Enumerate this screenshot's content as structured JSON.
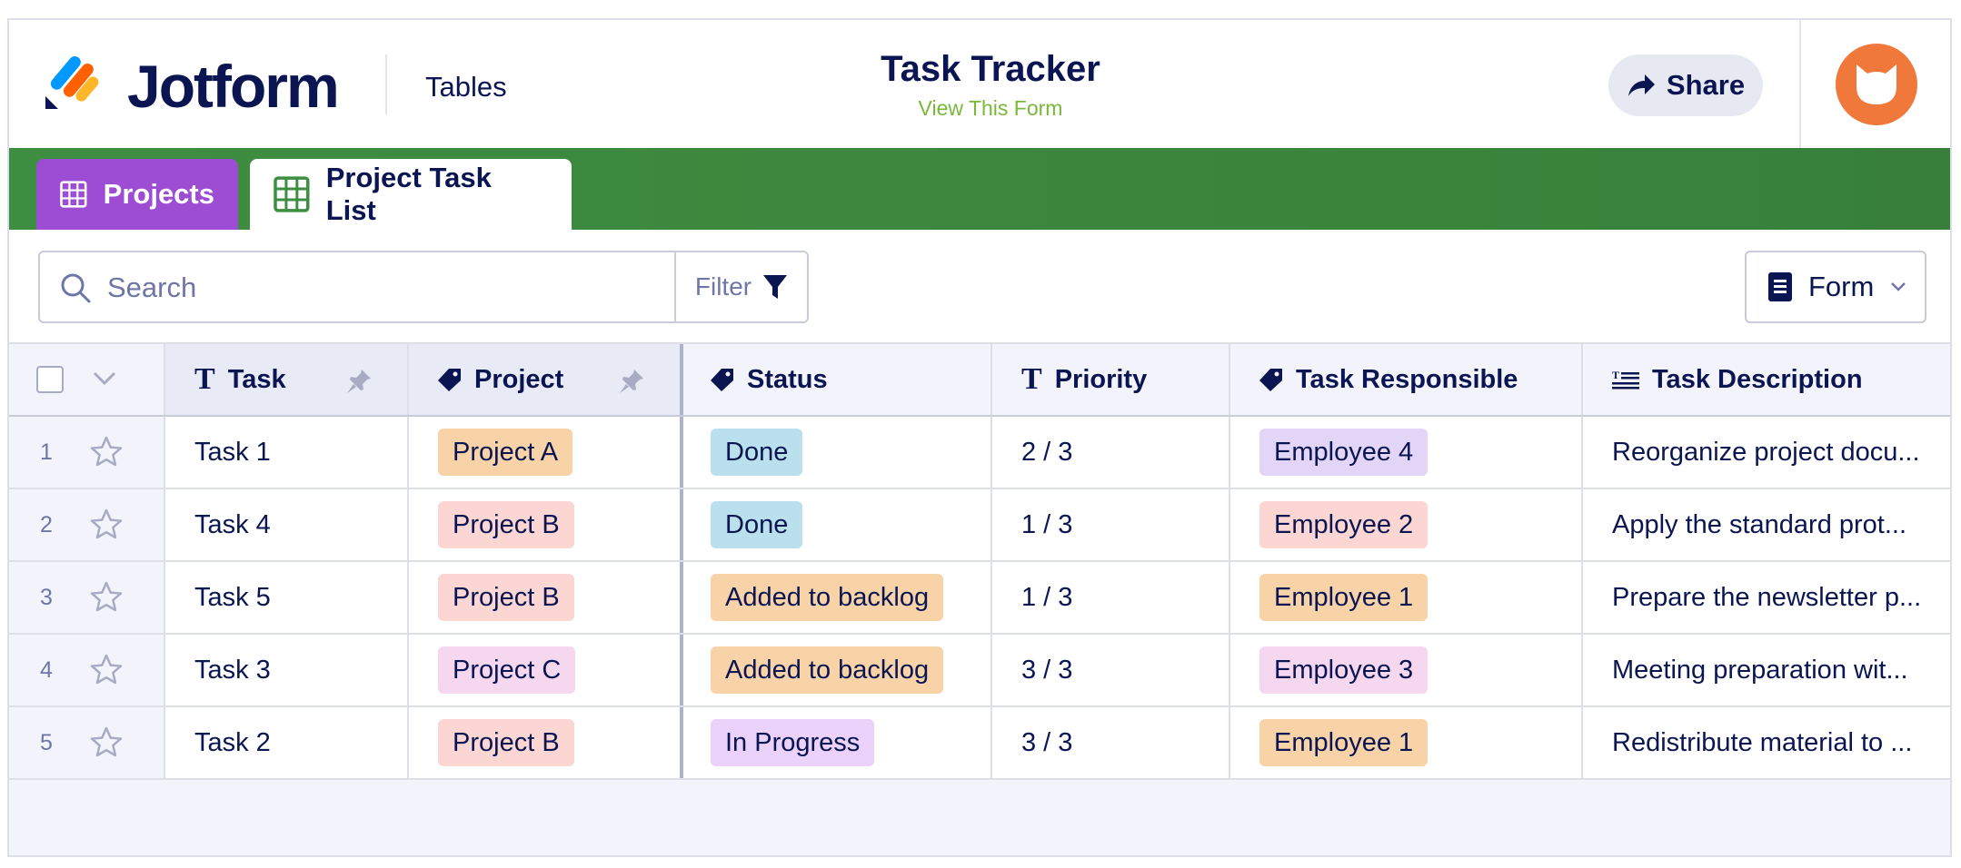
{
  "header": {
    "brand": "Jotform",
    "section": "Tables",
    "title": "Task Tracker",
    "view_form": "View This Form",
    "share_label": "Share"
  },
  "tabs": [
    {
      "label": "Projects",
      "color": "#9c4dd3",
      "icon": "grid-icon"
    },
    {
      "label": "Project Task List",
      "color": "#ffffff",
      "icon": "grid-icon"
    }
  ],
  "toolbar": {
    "search_placeholder": "Search",
    "filter_label": "Filter",
    "form_label": "Form"
  },
  "table": {
    "columns": [
      {
        "label": "Task",
        "icon": "text-type-icon"
      },
      {
        "label": "Project",
        "icon": "tag-icon"
      },
      {
        "label": "Status",
        "icon": "tag-icon"
      },
      {
        "label": "Priority",
        "icon": "text-type-icon"
      },
      {
        "label": "Task Responsible",
        "icon": "tag-icon"
      },
      {
        "label": "Task Description",
        "icon": "long-text-icon"
      }
    ],
    "rows": [
      {
        "num": "1",
        "task": "Task 1",
        "project": "Project A",
        "status": "Done",
        "priority": "2 / 3",
        "responsible": "Employee 4",
        "description": "Reorganize project docu..."
      },
      {
        "num": "2",
        "task": "Task 4",
        "project": "Project B",
        "status": "Done",
        "priority": "1 / 3",
        "responsible": "Employee 2",
        "description": "Apply the standard prot..."
      },
      {
        "num": "3",
        "task": "Task 5",
        "project": "Project B",
        "status": "Added to backlog",
        "priority": "1 / 3",
        "responsible": "Employee 1",
        "description": "Prepare the newsletter p..."
      },
      {
        "num": "4",
        "task": "Task 3",
        "project": "Project C",
        "status": "Added to backlog",
        "priority": "3 / 3",
        "responsible": "Employee 3",
        "description": "Meeting preparation wit..."
      },
      {
        "num": "5",
        "task": "Task 2",
        "project": "Project B",
        "status": "In Progress",
        "priority": "3 / 3",
        "responsible": "Employee 1",
        "description": "Redistribute material to ..."
      }
    ]
  },
  "tag_colors": {
    "Project A": "#f9d3a8",
    "Project B": "#fbd6d2",
    "Project C": "#f6d7f0",
    "Done": "#b9e0ec",
    "Added to backlog": "#f9d3a8",
    "In Progress": "#ebd2fb",
    "Employee 4": "#e3d5f8",
    "Employee 2": "#fbd6d2",
    "Employee 1": "#f9d3a8",
    "Employee 3": "#f6d7f0"
  }
}
